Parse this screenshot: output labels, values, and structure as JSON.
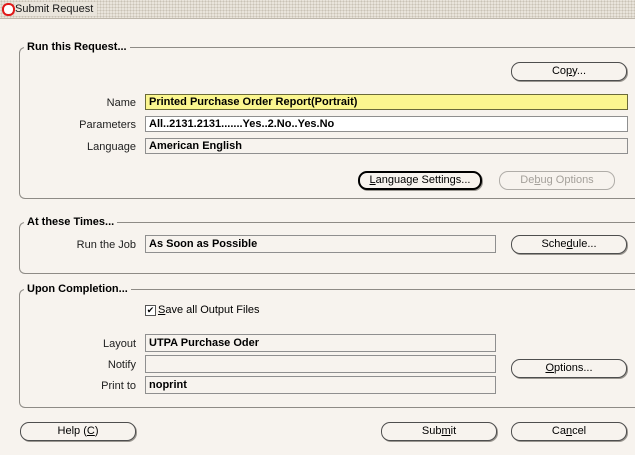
{
  "window": {
    "title": "Submit Request"
  },
  "run_section": {
    "title": "Run this Request...",
    "copy_button": {
      "pre": "Co",
      "key": "p",
      "post": "y..."
    },
    "name_label": "Name",
    "name_value": "Printed Purchase Order Report(Portrait)",
    "parameters_label": "Parameters",
    "parameters_value": "All..2131.2131.......Yes..2.No..Yes.No",
    "language_label": "Language",
    "language_value": "American English",
    "language_settings_button": {
      "pre": "",
      "key": "L",
      "post": "anguage Settings..."
    },
    "debug_options_button": {
      "pre": "De",
      "key": "b",
      "post": "ug Options"
    }
  },
  "times_section": {
    "title": "At these Times...",
    "run_job_label": "Run the Job",
    "run_job_value": "As Soon as Possible",
    "schedule_button": {
      "pre": "Sche",
      "key": "d",
      "post": "ule..."
    }
  },
  "completion_section": {
    "title": "Upon Completion...",
    "save_output": {
      "pre": "",
      "key": "S",
      "post": "ave all Output Files",
      "checked": true,
      "mark": "✔"
    },
    "layout_label": "Layout",
    "layout_value": "UTPA Purchase Oder",
    "notify_label": "Notify",
    "notify_value": "",
    "print_to_label": "Print to",
    "print_to_value": "noprint",
    "options_button": {
      "pre": "",
      "key": "O",
      "post": "ptions..."
    }
  },
  "footer": {
    "help_button": {
      "pre": "Help (",
      "key": "C",
      "post": ")"
    },
    "submit_button": {
      "pre": "Sub",
      "key": "m",
      "post": "it"
    },
    "cancel_button": {
      "pre": "Ca",
      "key": "n",
      "post": "cel"
    }
  }
}
